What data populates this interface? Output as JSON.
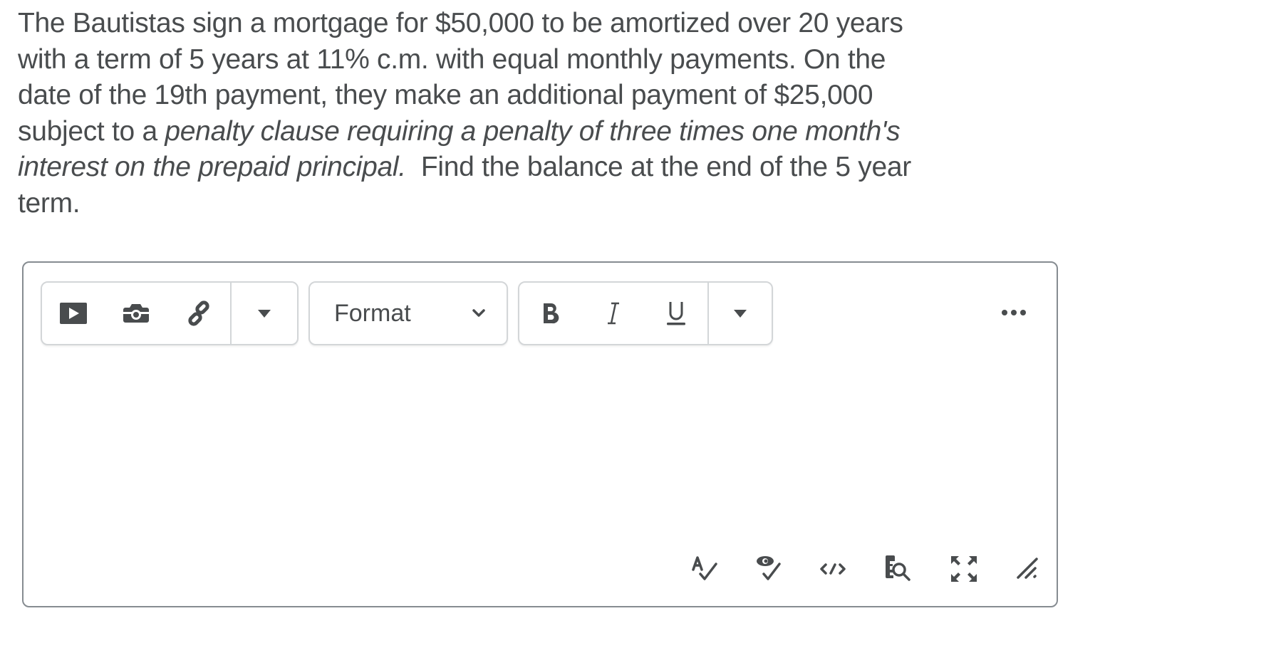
{
  "question": {
    "line1": "The Bautistas sign a mortgage for $50,000 to be amortized over 20 years",
    "line2": "with a term of 5 years at 11% c.m. with equal monthly payments.  On the",
    "line3": "date of the 19th payment, they make an additional payment of $25,000",
    "line4_normal": "subject to a ",
    "line4_italic": "penalty clause requiring a penalty of three times one month's",
    "line5_italic": "interest on the prepaid principal.",
    "line5_normal": "  Find the balance at the end of the 5 year",
    "line6": "term."
  },
  "editor": {
    "toolbar": {
      "insert_group": [
        {
          "icon": "video-play-icon",
          "label": "Insert Stuff"
        },
        {
          "icon": "camera-icon",
          "label": "Insert Image"
        },
        {
          "icon": "link-icon",
          "label": "Insert Link"
        },
        {
          "icon": "caret-down-icon",
          "label": "More insert options"
        }
      ],
      "format_select": {
        "value": "Format",
        "icon": "chevron-down-icon"
      },
      "style_group": [
        {
          "icon": "bold-icon",
          "label": "B"
        },
        {
          "icon": "italic-icon",
          "label": "I"
        },
        {
          "icon": "underline-icon",
          "label": "U"
        },
        {
          "icon": "caret-down-icon",
          "label": "More styles"
        }
      ],
      "more_actions": {
        "icon": "ellipsis-icon",
        "label": "..."
      }
    },
    "content": "",
    "status_bar": [
      {
        "icon": "spellcheck-icon"
      },
      {
        "icon": "accessibility-check-icon"
      },
      {
        "icon": "source-code-icon"
      },
      {
        "icon": "find-replace-icon"
      },
      {
        "icon": "fullscreen-icon"
      },
      {
        "icon": "resize-handle-icon"
      }
    ]
  },
  "colors": {
    "text": "#494c4e",
    "border": "#868c91",
    "group_border": "#d3d6d8"
  }
}
